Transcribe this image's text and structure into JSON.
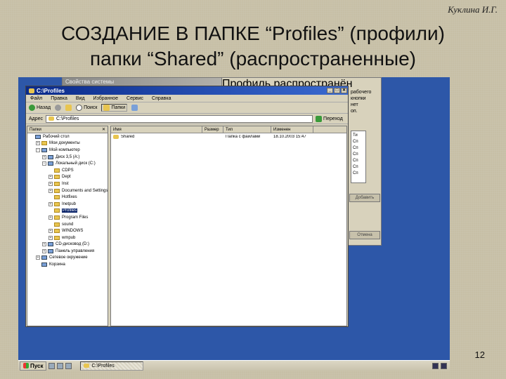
{
  "author": "Куклина И.Г.",
  "slide": {
    "title_line1": "СОЗДАНИЕ В ПАПКЕ “Profiles” (профили)",
    "title_line2": "папки “Shared” (распространенные)",
    "page_number": "12"
  },
  "properties_window": {
    "title": "Свойства системы"
  },
  "share_window": {
    "title": "Профиль распространён",
    "side_text": [
      "рабочего",
      "кнопки",
      "нет",
      "оп."
    ],
    "list_head": "Ти",
    "list_items": [
      "Сп",
      "Сп",
      "Сп",
      "Сп",
      "Сп",
      "Сп"
    ],
    "button1": "Добавить",
    "button2": "Отмена"
  },
  "explorer": {
    "title": "C:\\Profiles",
    "menu": [
      "Файл",
      "Правка",
      "Вид",
      "Избранное",
      "Сервис",
      "Справка"
    ],
    "toolbar": {
      "back": "Назад",
      "search": "Поиск",
      "folders": "Папки"
    },
    "address_label": "Адрес",
    "address_value": "C:\\Profiles",
    "go_label": "Переход",
    "tree_header": "Папки",
    "tree_close": "✕",
    "tree": [
      {
        "label": "Рабочий стол",
        "indent": 0,
        "pm": "",
        "blue": true
      },
      {
        "label": "Мои документы",
        "indent": 1,
        "pm": "+",
        "blue": false
      },
      {
        "label": "Мой компьютер",
        "indent": 1,
        "pm": "−",
        "blue": true
      },
      {
        "label": "Диск 3,5 (A:)",
        "indent": 2,
        "pm": "+",
        "blue": true
      },
      {
        "label": "Локальный диск (C:)",
        "indent": 2,
        "pm": "−",
        "blue": true
      },
      {
        "label": "CDPS",
        "indent": 3,
        "pm": "",
        "blue": false
      },
      {
        "label": "Dept",
        "indent": 3,
        "pm": "+",
        "blue": false
      },
      {
        "label": "Inst",
        "indent": 3,
        "pm": "+",
        "blue": false
      },
      {
        "label": "Documents and Settings",
        "indent": 3,
        "pm": "+",
        "blue": false
      },
      {
        "label": "Hotfixes",
        "indent": 3,
        "pm": "",
        "blue": false
      },
      {
        "label": "Inetpub",
        "indent": 3,
        "pm": "+",
        "blue": false
      },
      {
        "label": "Profiles",
        "indent": 3,
        "pm": "",
        "blue": false,
        "selected": true
      },
      {
        "label": "Program Files",
        "indent": 3,
        "pm": "+",
        "blue": false
      },
      {
        "label": "sound",
        "indent": 3,
        "pm": "",
        "blue": false
      },
      {
        "label": "WINDOWS",
        "indent": 3,
        "pm": "+",
        "blue": false
      },
      {
        "label": "wmpub",
        "indent": 3,
        "pm": "+",
        "blue": false
      },
      {
        "label": "CD-дисковод (D:)",
        "indent": 2,
        "pm": "+",
        "blue": true
      },
      {
        "label": "Панель управления",
        "indent": 2,
        "pm": "+",
        "blue": true
      },
      {
        "label": "Сетевое окружение",
        "indent": 1,
        "pm": "+",
        "blue": true
      },
      {
        "label": "Корзина",
        "indent": 1,
        "pm": "",
        "blue": true
      }
    ],
    "columns": [
      "Имя",
      "Размер",
      "Тип",
      "Изменен"
    ],
    "rows": [
      {
        "name": "Shared",
        "size": "",
        "type": "Папка с файлами",
        "modified": "18.10.2003 15:47"
      }
    ]
  },
  "taskbar": {
    "start": "Пуск",
    "task": "C:\\Profiles"
  },
  "colors": {
    "slide_bg": "#c7bfa6",
    "desktop": "#2d57a8",
    "titlebar": "#0a2a8a",
    "selection": "#0a246a"
  }
}
